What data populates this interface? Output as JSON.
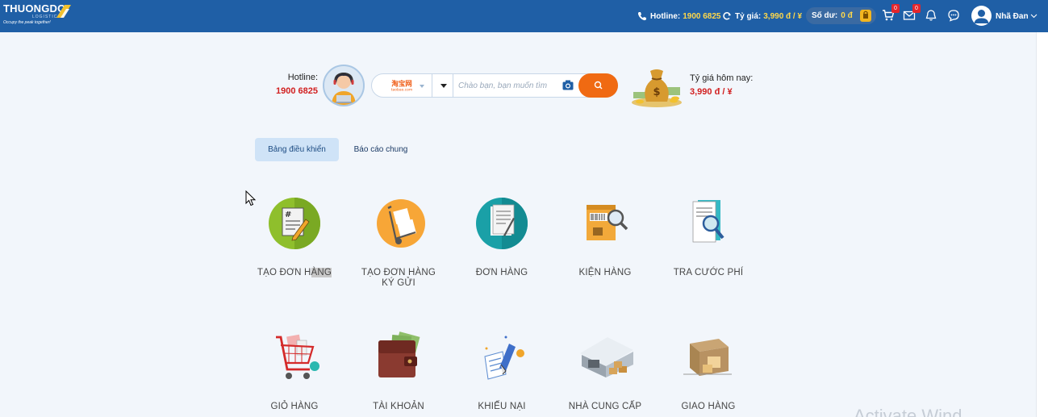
{
  "header": {
    "logo_main": "THUONGDO",
    "logo_sub": "LOGISTICS",
    "logo_slogan": "Occupy the peak together!",
    "hotline_label": "Hotline:",
    "hotline_value": "1900 6825",
    "rate_label": "Tỷ giá:",
    "rate_value": "3,990 đ / ¥",
    "balance_label": "Số dư:",
    "balance_value": "0 đ",
    "cart_count": "0",
    "mail_count": "0",
    "user_name": "Nhã Đan"
  },
  "search": {
    "hotline_label": "Hotline:",
    "hotline_value": "1900 6825",
    "site_selected": "Taobao",
    "placeholder": "Chào bạn, bạn muốn tìm",
    "rate_label": "Tỷ giá hôm nay:",
    "rate_value": "3,990 đ / ¥"
  },
  "tabs": [
    {
      "label": "Bảng điều khiển",
      "active": true
    },
    {
      "label": "Báo cáo chung",
      "active": false
    }
  ],
  "tiles": [
    {
      "label_a": "TẠO ĐƠN H",
      "label_b": "ÀNG",
      "icon": "create-order-icon"
    },
    {
      "label": "TẠO ĐƠN HÀNG",
      "label2": "KÝ GỬI",
      "icon": "consignment-order-icon"
    },
    {
      "label": "ĐƠN HÀNG",
      "icon": "orders-icon"
    },
    {
      "label": "KIỆN HÀNG",
      "icon": "package-icon"
    },
    {
      "label": "TRA CƯỚC PHÍ",
      "icon": "fee-lookup-icon"
    },
    {
      "label": "GIỎ HÀNG",
      "icon": "cart-icon"
    },
    {
      "label": "TÀI KHOẢN",
      "icon": "wallet-icon"
    },
    {
      "label": "KHIẾU NẠI",
      "icon": "complaint-icon"
    },
    {
      "label": "NHÀ CUNG CẤP",
      "icon": "supplier-icon"
    },
    {
      "label": "GIAO HÀNG",
      "icon": "delivery-icon"
    }
  ],
  "watermark": "Activate Wind"
}
